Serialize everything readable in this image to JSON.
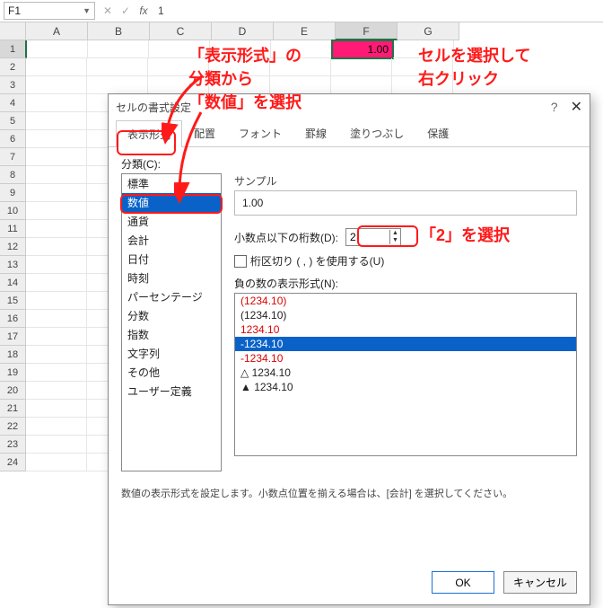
{
  "namebox": "F1",
  "formula_value": "1",
  "columns": [
    "A",
    "B",
    "C",
    "D",
    "E",
    "F",
    "G"
  ],
  "rows": [
    "1",
    "2",
    "3",
    "4",
    "5",
    "6",
    "7",
    "8",
    "9",
    "10",
    "11",
    "12",
    "13",
    "14",
    "15",
    "16",
    "17",
    "18",
    "19",
    "20",
    "21",
    "22",
    "23",
    "24"
  ],
  "active_cell_value": "1.00",
  "annot1a": "「表示形式」の",
  "annot1b": "分類から",
  "annot1c": "「数値」を選択",
  "annot2a": "セルを選択して",
  "annot2b": "右クリック",
  "annot3": "「2」を選択",
  "dialog": {
    "title": "セルの書式設定",
    "help": "?",
    "close": "✕",
    "tabs": [
      "表示形式",
      "配置",
      "フォント",
      "罫線",
      "塗りつぶし",
      "保護"
    ],
    "cat_label": "分類(C):",
    "categories": [
      "標準",
      "数値",
      "通貨",
      "会計",
      "日付",
      "時刻",
      "パーセンテージ",
      "分数",
      "指数",
      "文字列",
      "その他",
      "ユーザー定義"
    ],
    "sample_label": "サンプル",
    "sample_value": "1.00",
    "dec_label": "小数点以下の桁数(D):",
    "dec_value": "2",
    "chk_label": "桁区切り ( , ) を使用する(U)",
    "neg_label": "負の数の表示形式(N):",
    "neg_items": [
      {
        "t": "(1234.10)",
        "c": "red"
      },
      {
        "t": "(1234.10)",
        "c": ""
      },
      {
        "t": "1234.10",
        "c": "red"
      },
      {
        "t": "-1234.10",
        "c": "sel"
      },
      {
        "t": "-1234.10",
        "c": "red"
      },
      {
        "t": "△ 1234.10",
        "c": ""
      },
      {
        "t": "▲ 1234.10",
        "c": ""
      }
    ],
    "desc": "数値の表示形式を設定します。小数点位置を揃える場合は、[会計] を選択してください。",
    "ok": "OK",
    "cancel": "キャンセル"
  }
}
